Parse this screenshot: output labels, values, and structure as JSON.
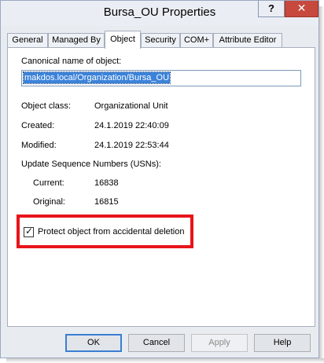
{
  "window": {
    "title": "Bursa_OU Properties",
    "help_label": "?",
    "close_label": "✕"
  },
  "tabs": [
    {
      "label": "General"
    },
    {
      "label": "Managed By"
    },
    {
      "label": "Object"
    },
    {
      "label": "Security"
    },
    {
      "label": "COM+"
    },
    {
      "label": "Attribute Editor"
    }
  ],
  "object_tab": {
    "canonical_label": "Canonical name of object:",
    "canonical_value": "makdos.local/Organization/Bursa_OU",
    "object_class_label": "Object class:",
    "object_class_value": "Organizational Unit",
    "created_label": "Created:",
    "created_value": "24.1.2019 22:40:09",
    "modified_label": "Modified:",
    "modified_value": "24.1.2019 22:53:44",
    "usn_label": "Update Sequence Numbers (USNs):",
    "current_label": "Current:",
    "current_value": "16838",
    "original_label": "Original:",
    "original_value": "16815",
    "protect_label": "Protect object from accidental deletion",
    "protect_checked": true
  },
  "buttons": {
    "ok": "OK",
    "cancel": "Cancel",
    "apply": "Apply",
    "help": "Help"
  },
  "colors": {
    "highlight": "#e8141b",
    "selection": "#3b82d9",
    "close": "#c7483d"
  }
}
